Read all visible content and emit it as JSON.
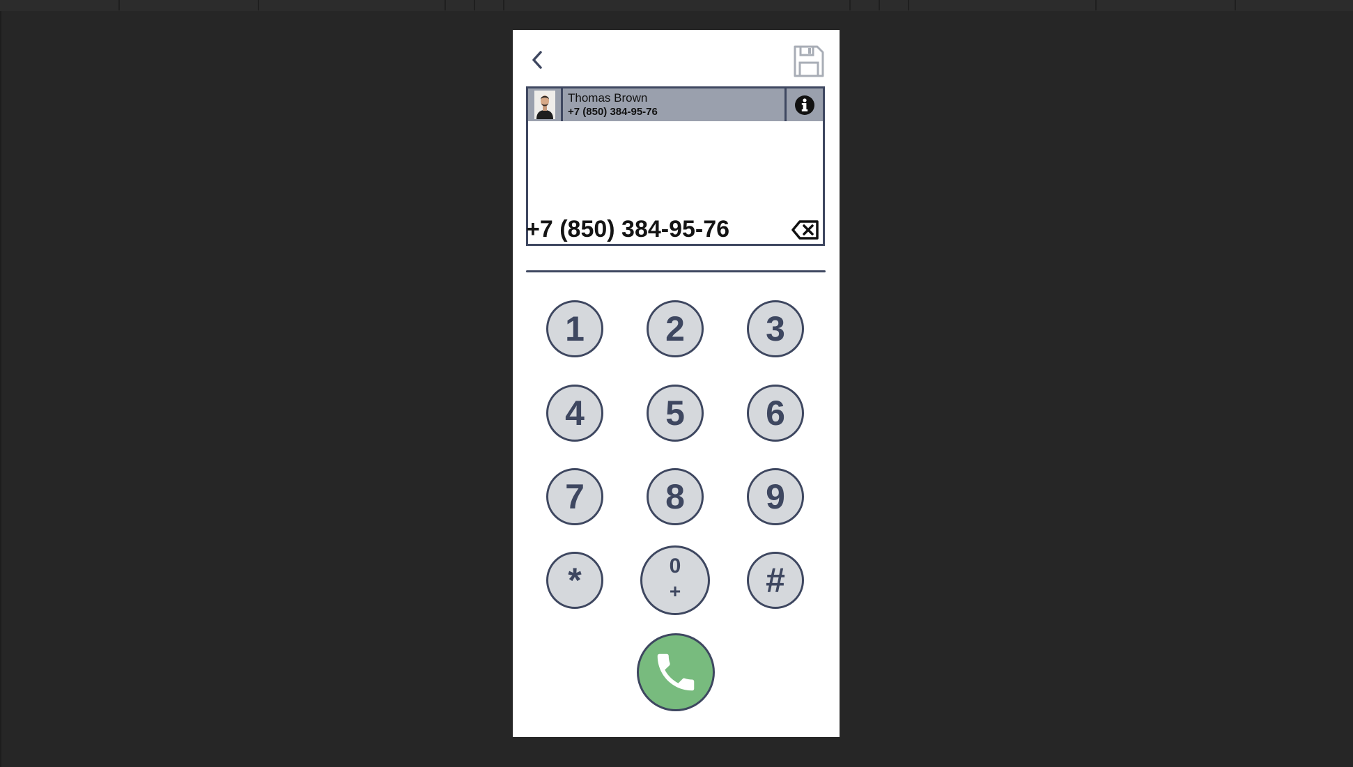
{
  "contact": {
    "name": "Thomas Brown",
    "phone": "+7 (850) 384-95-76"
  },
  "dialer": {
    "number": "+7 (850) 384-95-76",
    "keys": {
      "k1": "1",
      "k2": "2",
      "k3": "3",
      "k4": "4",
      "k5": "5",
      "k6": "6",
      "k7": "7",
      "k8": "8",
      "k9": "9",
      "star": "*",
      "zero": "0",
      "zero_sub": "+",
      "hash": "#"
    }
  },
  "icons": {
    "back": "chevron-left-icon",
    "save": "floppy-disk-icon",
    "info": "info-icon",
    "backspace": "backspace-icon",
    "call": "phone-icon"
  },
  "colors": {
    "page_background": "#262626",
    "panel": "#ffffff",
    "accent": "#3e4760",
    "key_fill": "#d5d8dc",
    "contact_row": "#9aa0ad",
    "call": "#78bb7e"
  }
}
